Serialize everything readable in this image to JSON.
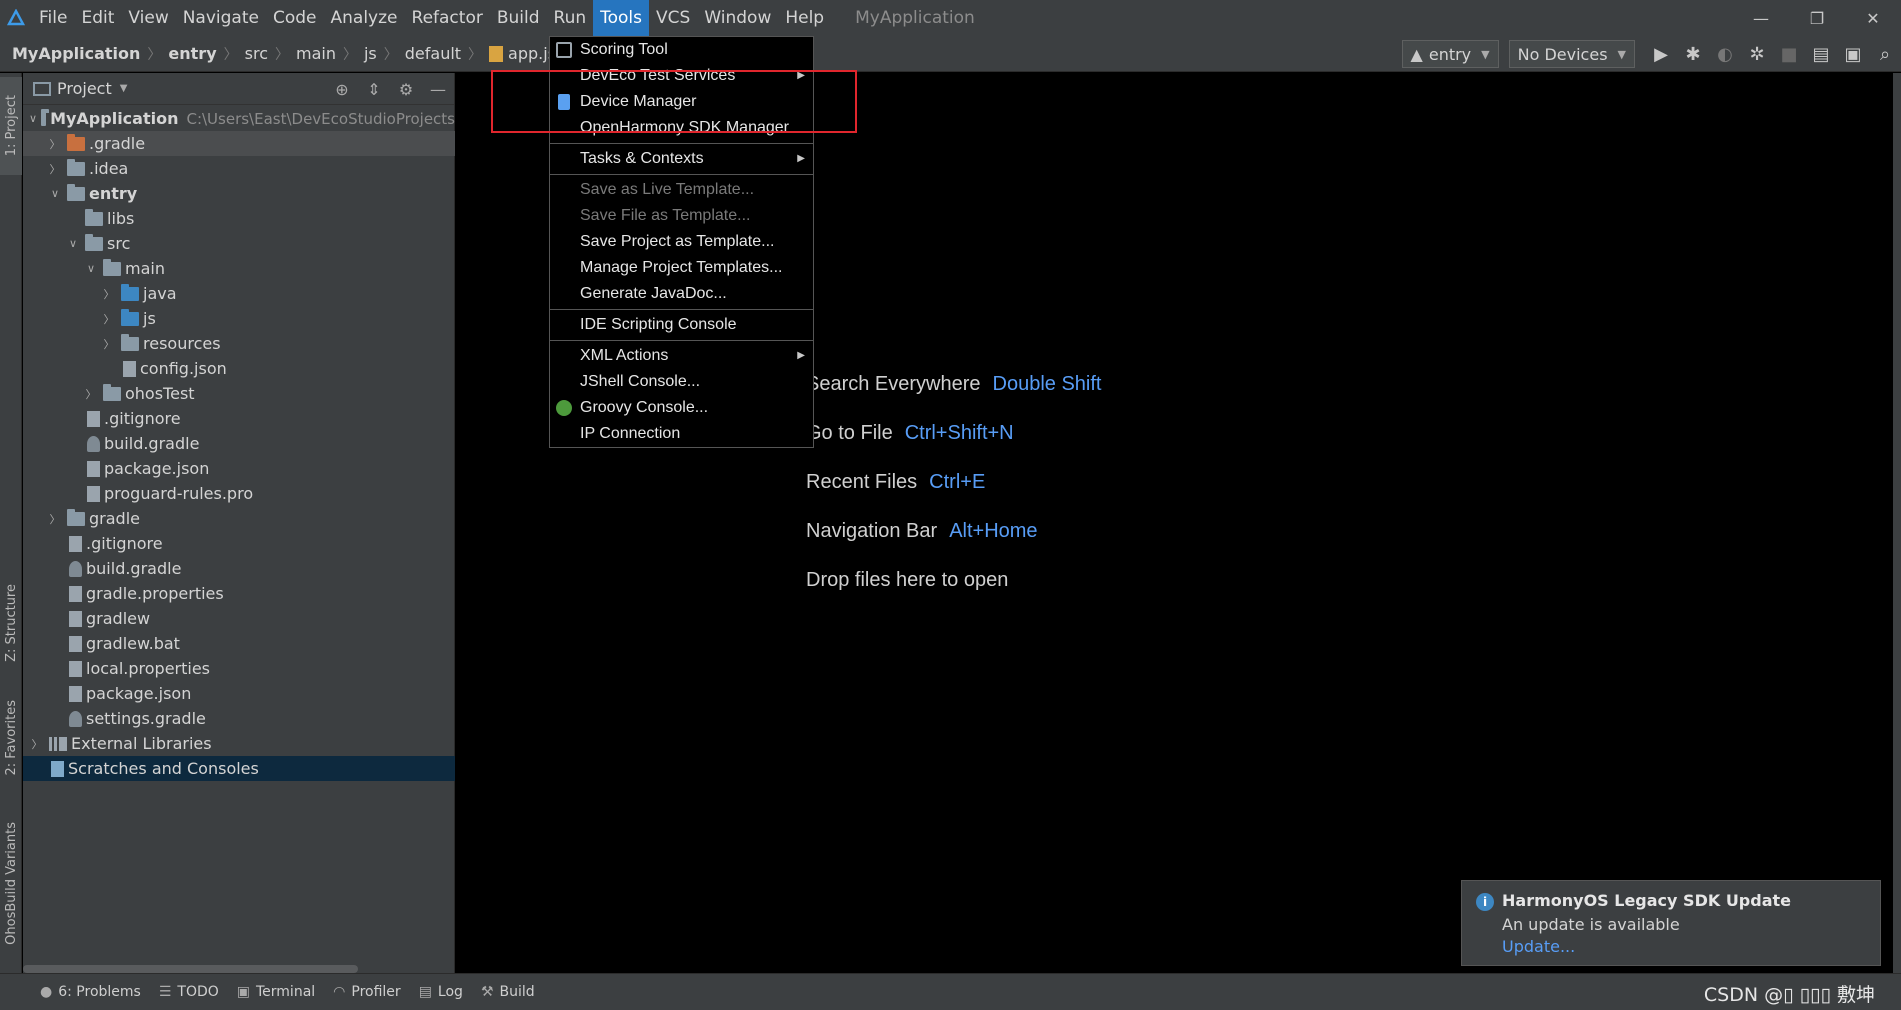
{
  "menubar": {
    "items": [
      "File",
      "Edit",
      "View",
      "Navigate",
      "Code",
      "Analyze",
      "Refactor",
      "Build",
      "Run",
      "Tools",
      "VCS",
      "Window",
      "Help"
    ],
    "active_item": "Tools",
    "window_title": "MyApplication",
    "controls": {
      "minimize": "—",
      "restore": "❐",
      "close": "✕"
    }
  },
  "breadcrumb": {
    "project": "MyApplication",
    "module": "entry",
    "parts": [
      "src",
      "main",
      "js",
      "default"
    ],
    "file": "app.js"
  },
  "toolbar": {
    "run_config": "entry",
    "device": "No Devices",
    "icons": [
      "run-icon",
      "debug-icon",
      "attach-debugger-icon",
      "profile-icon",
      "stop-icon",
      "project-structure-icon",
      "device-manager-icon",
      "search-icon"
    ]
  },
  "left_stripe": {
    "tabs": [
      "1: Project",
      "Z: Structure",
      "2: Favorites",
      "OhosBuild Variants"
    ]
  },
  "project_panel": {
    "title": "Project",
    "tree": [
      {
        "depth": 0,
        "arrow": "open",
        "icon": "module",
        "label": "MyApplication",
        "bold": true,
        "path": "C:\\Users\\East\\DevEcoStudioProjects"
      },
      {
        "depth": 1,
        "arrow": "closed",
        "icon": "folder-orange",
        "label": ".gradle",
        "selected": "light"
      },
      {
        "depth": 1,
        "arrow": "closed",
        "icon": "folder",
        "label": ".idea"
      },
      {
        "depth": 1,
        "arrow": "open",
        "icon": "folder",
        "label": "entry",
        "bold": true
      },
      {
        "depth": 2,
        "arrow": "none",
        "icon": "folder",
        "label": "libs"
      },
      {
        "depth": 2,
        "arrow": "open",
        "icon": "folder",
        "label": "src"
      },
      {
        "depth": 3,
        "arrow": "open",
        "icon": "folder",
        "label": "main"
      },
      {
        "depth": 4,
        "arrow": "closed",
        "icon": "folder-blue",
        "label": "java"
      },
      {
        "depth": 4,
        "arrow": "closed",
        "icon": "folder-blue",
        "label": "js"
      },
      {
        "depth": 4,
        "arrow": "closed",
        "icon": "folder",
        "label": "resources"
      },
      {
        "depth": 4,
        "arrow": "none",
        "icon": "file",
        "label": "config.json"
      },
      {
        "depth": 3,
        "arrow": "closed",
        "icon": "folder",
        "label": "ohosTest"
      },
      {
        "depth": 2,
        "arrow": "none",
        "icon": "file",
        "label": ".gitignore"
      },
      {
        "depth": 2,
        "arrow": "none",
        "icon": "gradle",
        "label": "build.gradle"
      },
      {
        "depth": 2,
        "arrow": "none",
        "icon": "file",
        "label": "package.json"
      },
      {
        "depth": 2,
        "arrow": "none",
        "icon": "file",
        "label": "proguard-rules.pro"
      },
      {
        "depth": 1,
        "arrow": "closed",
        "icon": "folder",
        "label": "gradle"
      },
      {
        "depth": 1,
        "arrow": "none",
        "icon": "file",
        "label": ".gitignore"
      },
      {
        "depth": 1,
        "arrow": "none",
        "icon": "gradle",
        "label": "build.gradle"
      },
      {
        "depth": 1,
        "arrow": "none",
        "icon": "file",
        "label": "gradle.properties"
      },
      {
        "depth": 1,
        "arrow": "none",
        "icon": "file",
        "label": "gradlew"
      },
      {
        "depth": 1,
        "arrow": "none",
        "icon": "file",
        "label": "gradlew.bat"
      },
      {
        "depth": 1,
        "arrow": "none",
        "icon": "file",
        "label": "local.properties"
      },
      {
        "depth": 1,
        "arrow": "none",
        "icon": "file",
        "label": "package.json"
      },
      {
        "depth": 1,
        "arrow": "none",
        "icon": "gradle",
        "label": "settings.gradle"
      },
      {
        "depth": 0,
        "arrow": "closed",
        "icon": "library",
        "label": "External Libraries"
      },
      {
        "depth": 0,
        "arrow": "none",
        "icon": "scratch",
        "label": "Scratches and Consoles",
        "selected": "dark"
      }
    ]
  },
  "tools_menu": {
    "items": [
      {
        "label": "Scoring Tool",
        "icon": "scoring-icon"
      },
      {
        "label": "DevEco Test Services",
        "submenu": true
      },
      {
        "label": "Device Manager",
        "icon": "device-icon"
      },
      {
        "label": "OpenHarmony SDK Manager"
      },
      {
        "separator": true
      },
      {
        "label": "Tasks & Contexts",
        "submenu": true
      },
      {
        "separator": true
      },
      {
        "label": "Save as Live Template...",
        "disabled": true
      },
      {
        "label": "Save File as Template...",
        "disabled": true
      },
      {
        "label": "Save Project as Template..."
      },
      {
        "label": "Manage Project Templates..."
      },
      {
        "label": "Generate JavaDoc..."
      },
      {
        "separator": true
      },
      {
        "label": "IDE Scripting Console"
      },
      {
        "separator": true
      },
      {
        "label": "XML Actions",
        "submenu": true
      },
      {
        "label": "JShell Console..."
      },
      {
        "label": "Groovy Console...",
        "icon": "groovy-icon"
      },
      {
        "label": "IP Connection"
      }
    ]
  },
  "editor_hints": [
    {
      "label": "Search Everywhere",
      "key": "Double Shift"
    },
    {
      "label": "Go to File",
      "key": "Ctrl+Shift+N"
    },
    {
      "label": "Recent Files",
      "key": "Ctrl+E"
    },
    {
      "label": "Navigation Bar",
      "key": "Alt+Home"
    },
    {
      "label": "Drop files here to open",
      "key": ""
    }
  ],
  "notification": {
    "title": "HarmonyOS Legacy SDK Update",
    "body": "An update is available",
    "link": "Update..."
  },
  "statusbar": {
    "items": [
      {
        "label": "6: Problems",
        "icon": "problems-icon"
      },
      {
        "label": "TODO",
        "icon": "todo-icon"
      },
      {
        "label": "Terminal",
        "icon": "terminal-icon"
      },
      {
        "label": "Profiler",
        "icon": "profiler-icon"
      },
      {
        "label": "Log",
        "icon": "log-icon"
      },
      {
        "label": "Build",
        "icon": "build-icon"
      }
    ],
    "watermark": "CSDN @▯ ▯▯▯ 敷坤"
  },
  "colors": {
    "accent": "#2675bf",
    "highlight_box": "#e0262d",
    "link": "#589df6"
  }
}
